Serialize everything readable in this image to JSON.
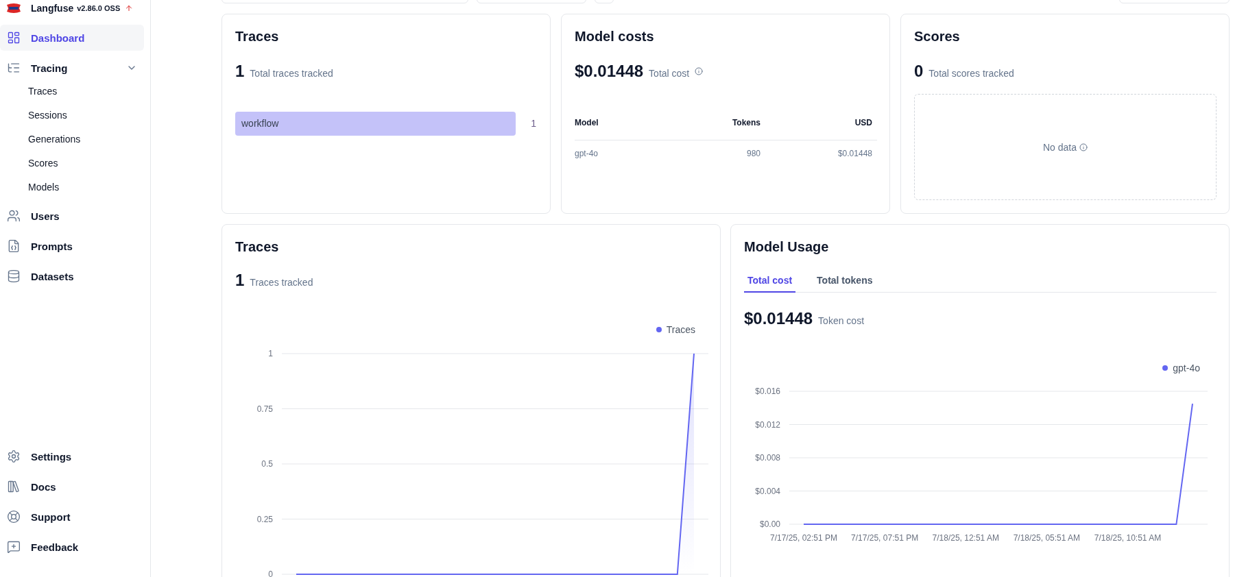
{
  "sidebar": {
    "app_name": "Langfuse",
    "version": "v2.86.0 OSS",
    "nav": [
      {
        "label": "Dashboard",
        "selected": true
      },
      {
        "label": "Tracing",
        "selected": false,
        "expanded": true,
        "children": [
          {
            "label": "Traces",
            "selected": false
          },
          {
            "label": "Sessions",
            "selected": false
          },
          {
            "label": "Generations",
            "selected": false
          },
          {
            "label": "Scores",
            "selected": false
          },
          {
            "label": "Models",
            "selected": false
          }
        ]
      },
      {
        "label": "Users",
        "selected": false
      },
      {
        "label": "Prompts",
        "selected": false
      },
      {
        "label": "Datasets",
        "selected": false
      }
    ],
    "footer": [
      {
        "label": "Settings",
        "selected": false
      },
      {
        "label": "Docs",
        "selected": false
      },
      {
        "label": "Support",
        "selected": false
      },
      {
        "label": "Feedback",
        "selected": false
      }
    ]
  },
  "traces_summary": {
    "title": "Traces",
    "count": "1",
    "caption": "Total traces tracked",
    "chart_data": {
      "type": "bar",
      "orientation": "horizontal",
      "categories": [
        "workflow"
      ],
      "values": [
        1
      ],
      "data_labels": true,
      "color": "#c4c2f9"
    }
  },
  "model_costs": {
    "title": "Model costs",
    "total": "$0.01448",
    "caption": "Total cost",
    "table": {
      "columns": [
        "Model",
        "Tokens",
        "USD"
      ],
      "rows": [
        [
          "gpt-4o",
          "980",
          "$0.01448"
        ]
      ]
    }
  },
  "scores": {
    "title": "Scores",
    "count": "0",
    "caption": "Total scores tracked",
    "empty_text": "No data"
  },
  "traces_chart": {
    "title": "Traces",
    "count": "1",
    "caption": "Traces tracked",
    "chart_data": {
      "type": "area",
      "grid": true,
      "categories": [
        null,
        null,
        null,
        null,
        null,
        null,
        null,
        null,
        null,
        null,
        null,
        null,
        null,
        null,
        null,
        null,
        null,
        null,
        null,
        null,
        null,
        null,
        null,
        null,
        null
      ],
      "series": [
        {
          "name": "Traces",
          "color": "#6366f1",
          "values": [
            0,
            0,
            0,
            0,
            0,
            0,
            0,
            0,
            0,
            0,
            0,
            0,
            0,
            0,
            0,
            0,
            0,
            0,
            0,
            0,
            0,
            0,
            0,
            0,
            1
          ]
        }
      ],
      "ylim": [
        0,
        1
      ],
      "yticks": [
        0,
        0.25,
        0.5,
        0.75,
        1
      ]
    }
  },
  "model_usage": {
    "title": "Model Usage",
    "tabs": [
      {
        "label": "Total cost",
        "selected": true
      },
      {
        "label": "Total tokens",
        "selected": false
      }
    ],
    "total": "$0.01448",
    "caption": "Token cost",
    "chart_data": {
      "type": "line",
      "grid": true,
      "categories": [
        "7/17/25, 02:51 PM",
        null,
        null,
        null,
        null,
        "7/17/25, 07:51 PM",
        null,
        null,
        null,
        null,
        "7/18/25, 12:51 AM",
        null,
        null,
        null,
        null,
        "7/18/25, 05:51 AM",
        null,
        null,
        null,
        null,
        "7/18/25, 10:51 AM",
        null,
        null,
        null,
        null
      ],
      "series": [
        {
          "name": "gpt-4o",
          "color": "#6366f1",
          "values": [
            0,
            0,
            0,
            0,
            0,
            0,
            0,
            0,
            0,
            0,
            0,
            0,
            0,
            0,
            0,
            0,
            0,
            0,
            0,
            0,
            0,
            0,
            0,
            0,
            0.0145
          ]
        }
      ],
      "ylim": [
        0,
        0.016
      ],
      "yticks": [
        {
          "value": 0,
          "label": "$0.00"
        },
        {
          "value": 0.004,
          "label": "$0.004"
        },
        {
          "value": 0.008,
          "label": "$0.008"
        },
        {
          "value": 0.012,
          "label": "$0.012"
        },
        {
          "value": 0.016,
          "label": "$0.016"
        }
      ]
    }
  }
}
